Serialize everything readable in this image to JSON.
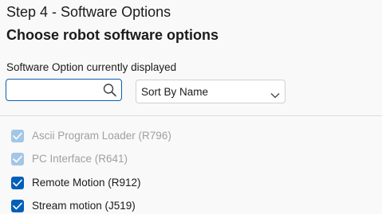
{
  "header": {
    "step_title": "Step 4 - Software Options",
    "page_title": "Choose robot software options"
  },
  "filter": {
    "label": "Software Option currently displayed",
    "search_value": "",
    "sort_selected": "Sort By Name"
  },
  "options": [
    {
      "label": "Ascii Program Loader (R796)",
      "checked": true,
      "enabled": false
    },
    {
      "label": "PC Interface (R641)",
      "checked": true,
      "enabled": false
    },
    {
      "label": "Remote Motion (R912)",
      "checked": true,
      "enabled": true
    },
    {
      "label": "Stream motion (J519)",
      "checked": true,
      "enabled": true
    }
  ],
  "colors": {
    "accent": "#005fb8",
    "disabled_check": "#a2c6e6",
    "disabled_text": "#a0a0a0"
  }
}
